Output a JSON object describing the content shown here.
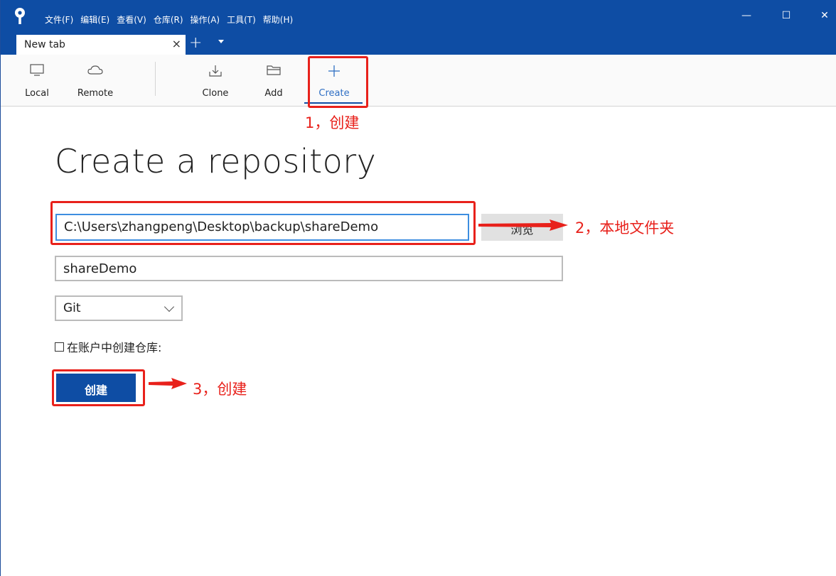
{
  "app": {
    "menu": [
      "文件(F)",
      "编辑(E)",
      "查看(V)",
      "仓库(R)",
      "操作(A)",
      "工具(T)",
      "帮助(H)"
    ],
    "window_controls": {
      "minimize": "—",
      "maximize": "☐",
      "close": "✕"
    }
  },
  "tabs": [
    {
      "label": "New tab",
      "close": "×"
    }
  ],
  "tab_add": "+",
  "toolbar": {
    "local": "Local",
    "remote": "Remote",
    "clone": "Clone",
    "add": "Add",
    "create": "Create"
  },
  "page": {
    "title": "Create a repository",
    "path_value": "C:\\Users\\zhangpeng\\Desktop\\backup\\shareDemo",
    "browse_label": "浏览",
    "name_value": "shareDemo",
    "type_value": "Git",
    "checkbox_label": "在账户中创建仓库:",
    "create_button": "创建"
  },
  "annotations": {
    "step1": "1，创建",
    "step2": "2，本地文件夹",
    "step3": "3，创建"
  },
  "colors": {
    "titlebar": "#0e4da4",
    "annotation": "#e8211b",
    "accent": "#3d8ee0"
  }
}
